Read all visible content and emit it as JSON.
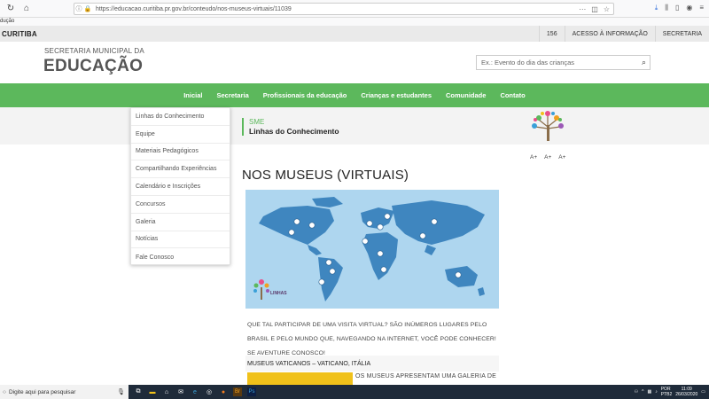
{
  "browser": {
    "url": "https://educacao.curitiba.pr.gov.br/conteudo/nos-museus-virtuais/11039",
    "bookmark": "dução"
  },
  "topbar": {
    "brand": "CURITIBA",
    "links": [
      "156",
      "ACESSO À INFORMAÇÃO",
      "SECRETARIA"
    ]
  },
  "header": {
    "line1": "SECRETARIA MUNICIPAL DA",
    "line2": "EDUCAÇÃO",
    "search_placeholder": "Ex.: Evento do dia das crianças"
  },
  "menu": [
    "Inicial",
    "Secretaria",
    "Profissionais da educação",
    "Crianças e estudantes",
    "Comunidade",
    "Contato"
  ],
  "dropdown": [
    "Linhas do Conhecimento",
    "Equipe",
    "Materiais Pedagógicos",
    "Compartilhando Experiências",
    "Calendário e Inscrições",
    "Concursos",
    "Galeria",
    "Notícias",
    "Fale Conosco"
  ],
  "section": {
    "sme": "SME",
    "subtitle": "Linhas do Conhecimento"
  },
  "fontsize": [
    "A+",
    "A+",
    "A+"
  ],
  "page_title": "NOS MUSEUS (VIRTUAIS)",
  "map_logo": "LINHAS",
  "paragraph": "QUE TAL PARTICIPAR DE UMA VISITA VIRTUAL? SÃO INÚMEROS LUGARES PELO BRASIL E PELO MUNDO QUE, NAVEGANDO NA INTERNET, VOCÊ PODE CONHECER! SE AVENTURE CONOSCO!",
  "vatican": "MUSEUS VATICANOS – VATICANO, ITÁLIA",
  "museus_text": "OS MUSEUS APRESENTAM UMA GALERIA DE",
  "taskbar": {
    "search": "Digite aqui para pesquisar",
    "lang1": "POR",
    "lang2": "PTB2",
    "time": "11:09",
    "date": "26/03/2020"
  }
}
